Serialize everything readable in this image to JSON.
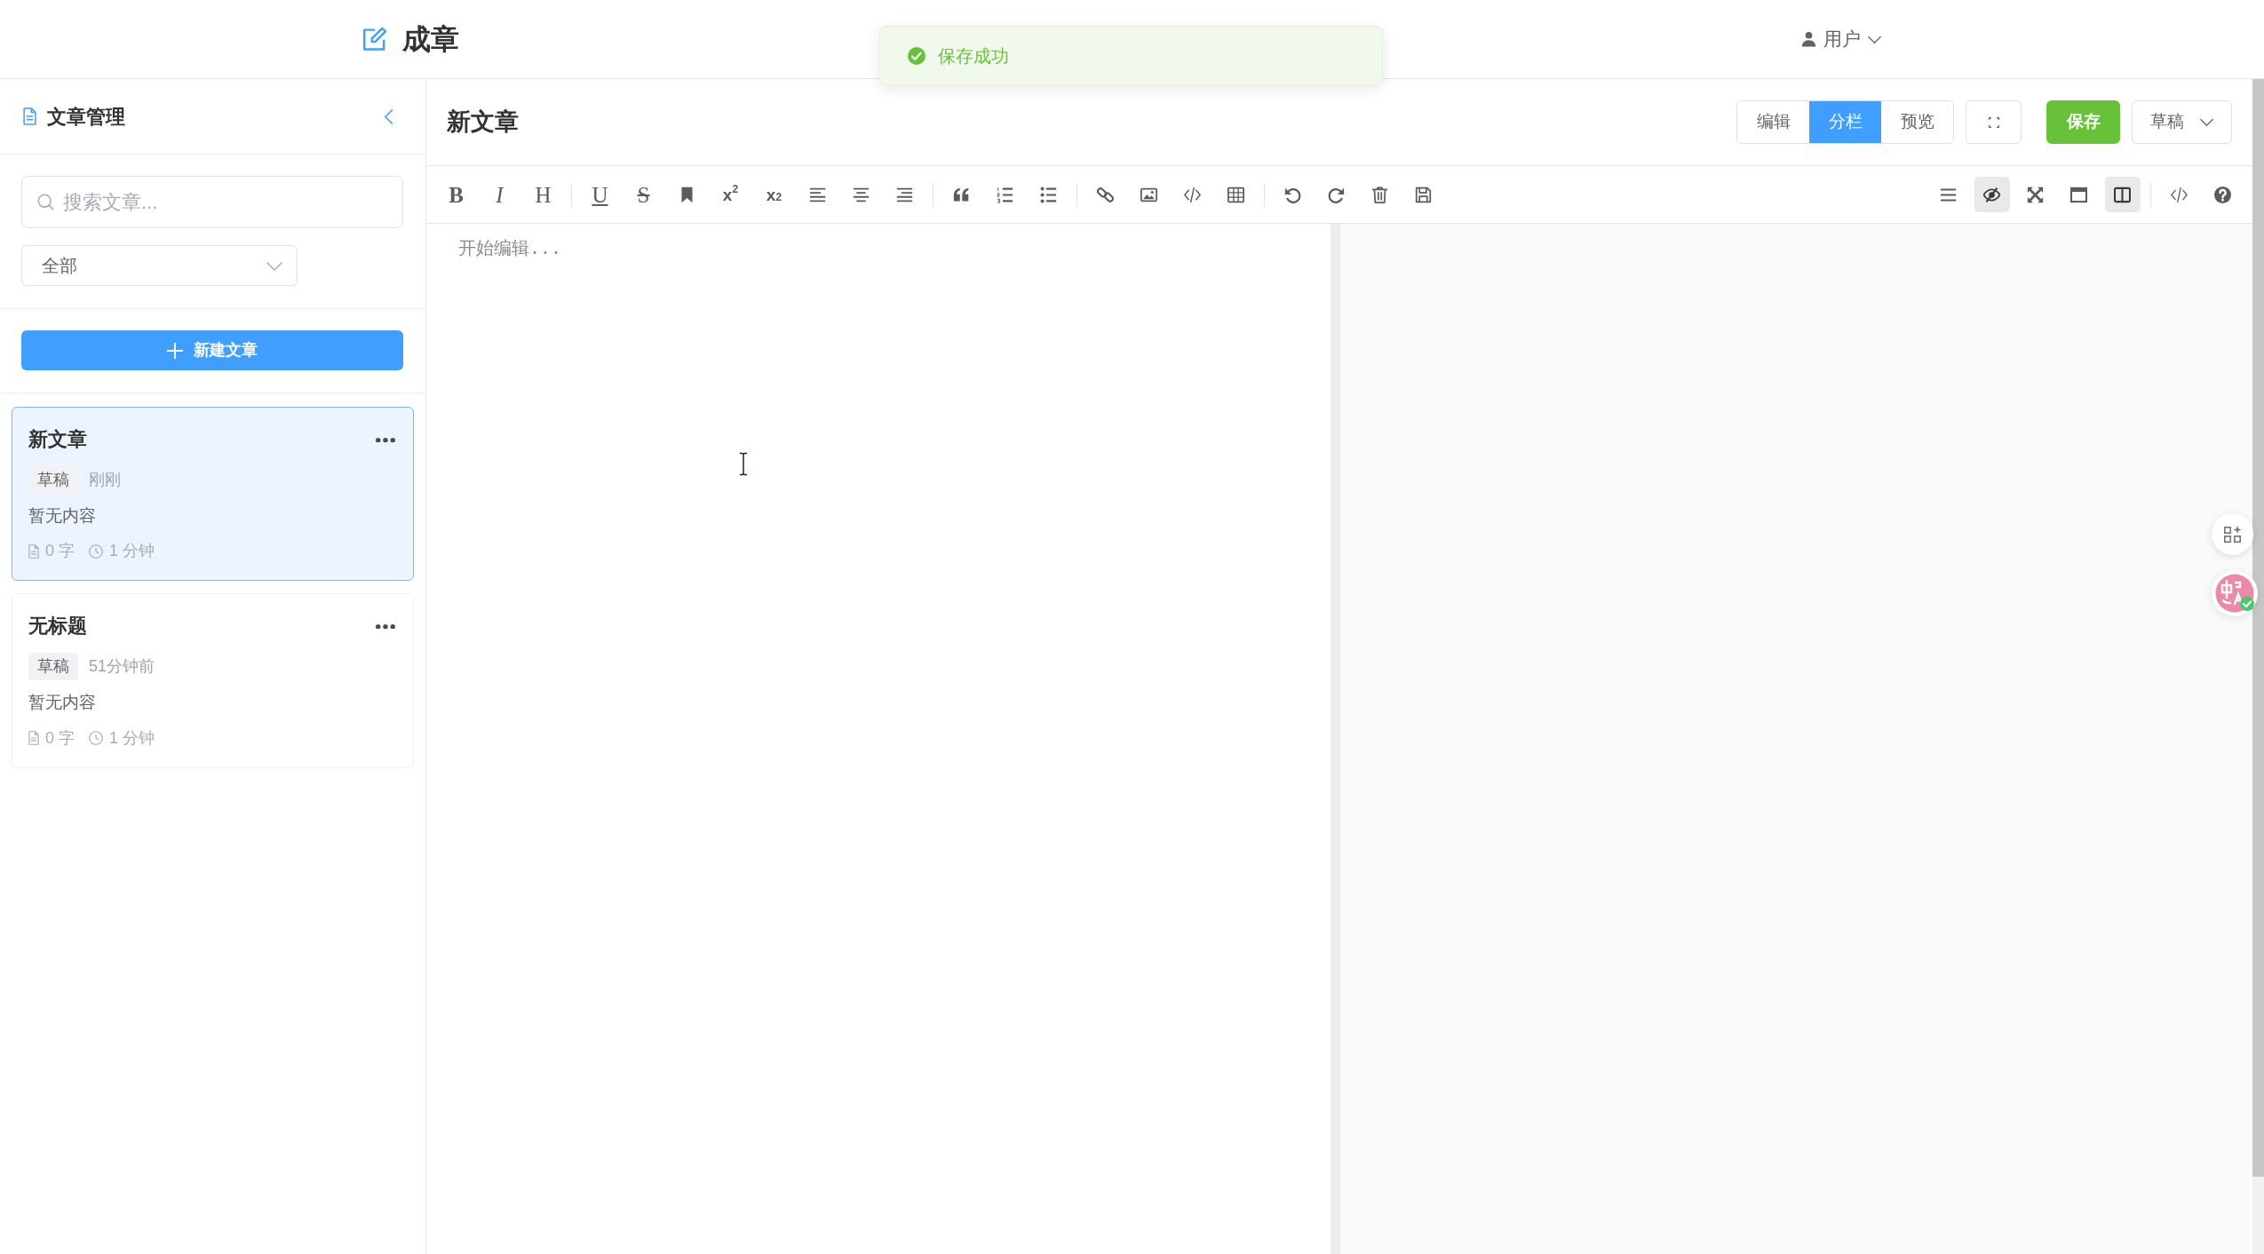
{
  "header": {
    "app_title": "成章",
    "user_menu": {
      "label": "用户"
    }
  },
  "toast": {
    "kind": "success",
    "message": "保存成功"
  },
  "sidebar": {
    "title": "文章管理",
    "search": {
      "placeholder": "搜索文章..."
    },
    "filter": {
      "value": "全部"
    },
    "new_button": {
      "label": "新建文章"
    },
    "articles": [
      {
        "title": "新文章",
        "status": "草稿",
        "updated": "刚刚",
        "excerpt": "暂无内容",
        "word_count": "0 字",
        "read_time": "1 分钟",
        "selected": true
      },
      {
        "title": "无标题",
        "status": "草稿",
        "updated": "51分钟前",
        "excerpt": "暂无内容",
        "word_count": "0 字",
        "read_time": "1 分钟",
        "selected": false
      }
    ]
  },
  "editor": {
    "title": "新文章",
    "view_modes": [
      {
        "label": "编辑",
        "selected": false
      },
      {
        "label": "分栏",
        "selected": true
      },
      {
        "label": "预览",
        "selected": false
      }
    ],
    "save_button": {
      "label": "保存"
    },
    "status_select": {
      "value": "草稿"
    },
    "toolbar": {
      "left_groups": [
        [
          {
            "kind": "bold",
            "glyph": "B"
          },
          {
            "kind": "italic",
            "glyph": "I"
          },
          {
            "kind": "heading",
            "glyph": "H"
          }
        ],
        [
          {
            "kind": "underline",
            "glyph": "U"
          },
          {
            "kind": "strikethrough",
            "glyph": "S"
          },
          {
            "kind": "bookmark"
          },
          {
            "kind": "superscript",
            "glyph": "x$^{2}$"
          },
          {
            "kind": "subscript",
            "glyph": "x$_{2}$"
          },
          {
            "kind": "alignleft"
          },
          {
            "kind": "aligncenter"
          },
          {
            "kind": "alignright"
          }
        ],
        [
          {
            "kind": "quote"
          },
          {
            "kind": "olist"
          },
          {
            "kind": "ulist"
          }
        ],
        [
          {
            "kind": "link"
          },
          {
            "kind": "image"
          },
          {
            "kind": "code"
          },
          {
            "kind": "table"
          }
        ],
        [
          {
            "kind": "undo"
          },
          {
            "kind": "redo"
          },
          {
            "kind": "trash"
          },
          {
            "kind": "save"
          }
        ]
      ],
      "right_groups": [
        [
          {
            "kind": "menu",
            "active": false
          },
          {
            "kind": "preview",
            "active": true
          },
          {
            "kind": "fullscreen",
            "active": false
          },
          {
            "kind": "window",
            "active": false
          },
          {
            "kind": "split",
            "active": true
          }
        ],
        [
          {
            "kind": "html",
            "active": false
          },
          {
            "kind": "help",
            "active": false
          }
        ]
      ]
    },
    "content": {
      "placeholder": "开始编辑..."
    }
  }
}
